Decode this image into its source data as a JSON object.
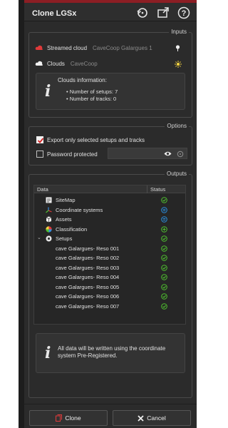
{
  "header": {
    "title": "Clone LGSx",
    "icons": [
      "restore-icon",
      "export-window-icon",
      "help-icon"
    ]
  },
  "inputs": {
    "section_label": "Inputs",
    "streamed_cloud_label": "Streamed cloud",
    "streamed_cloud_value": "CaveCoop Galargues 1",
    "clouds_label": "Clouds",
    "clouds_value": "CaveCoop",
    "info_title": "Clouds information:",
    "info_lines": [
      "Number of setups: 7",
      "Number of tracks: 0"
    ]
  },
  "options": {
    "section_label": "Options",
    "export_selected_label": "Export only selected setups and tracks",
    "export_selected_checked": true,
    "password_label": "Password protected",
    "password_checked": false
  },
  "outputs": {
    "section_label": "Outputs",
    "columns": [
      "Data",
      "Status"
    ],
    "rows": [
      {
        "name": "SiteMap",
        "icon": "sitemap-icon",
        "status": "ok"
      },
      {
        "name": "Coordinate systems",
        "icon": "axes-icon",
        "status": "list"
      },
      {
        "name": "Assets",
        "icon": "assets-icon",
        "status": "list"
      },
      {
        "name": "Classification",
        "icon": "classification-icon",
        "status": "add"
      },
      {
        "name": "Setups",
        "icon": "setups-icon",
        "status": "ok"
      },
      {
        "name": "cave Galargues- Reso 001",
        "status": "ok"
      },
      {
        "name": "cave Galargues- Reso 002",
        "status": "ok"
      },
      {
        "name": "cave Galargues- Reso 003",
        "status": "ok"
      },
      {
        "name": "cave Galargues- Reso 004",
        "status": "ok"
      },
      {
        "name": "cave Galargues- Reso 005",
        "status": "ok"
      },
      {
        "name": "cave Galargues- Reso 006",
        "status": "ok"
      },
      {
        "name": "cave Galargues- Reso 007",
        "status": "ok"
      }
    ],
    "note": "All data will be written using the coordinate system Pre-Registered."
  },
  "footer": {
    "clone_label": "Clone",
    "cancel_label": "Cancel"
  },
  "colors": {
    "accent": "#8c1e24",
    "ok_green": "#4fc12f",
    "list_blue": "#2a8fe0",
    "cloud_red": "#e03a3a",
    "checkbox_red": "#d42020"
  }
}
